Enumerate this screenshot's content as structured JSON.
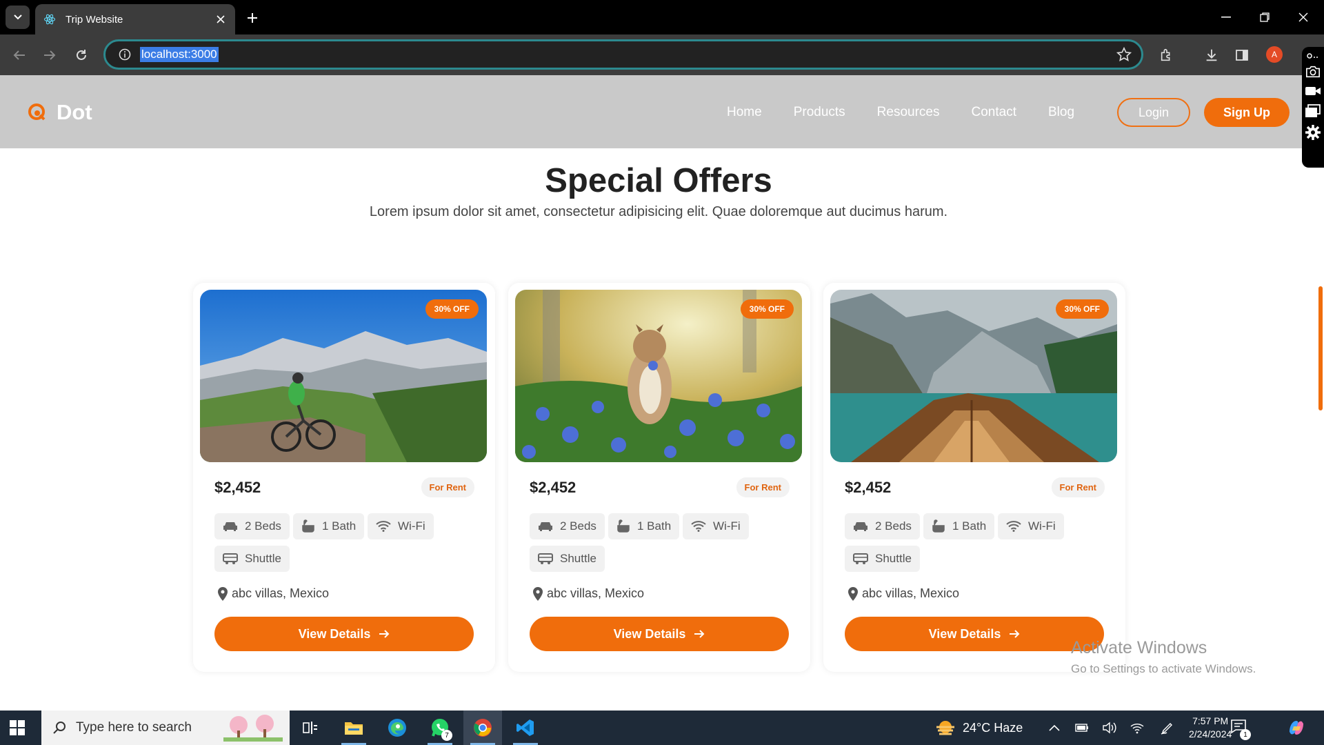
{
  "browser": {
    "tab_title": "Trip Website",
    "url": "localhost:3000",
    "avatar_letter": "A"
  },
  "site": {
    "brand": "Dot",
    "nav": [
      "Home",
      "Products",
      "Resources",
      "Contact",
      "Blog"
    ],
    "login_label": "Login",
    "signup_label": "Sign Up",
    "accent_color": "#f06d0c"
  },
  "section": {
    "title": "Special Offers",
    "subtitle": "Lorem ipsum dolor sit amet, consectetur adipisicing elit. Quae doloremque aut ducimus harum."
  },
  "offers": [
    {
      "badge": "30% OFF",
      "price": "$2,452",
      "tag": "For Rent",
      "beds": "2 Beds",
      "bath": "1 Bath",
      "wifi": "Wi-Fi",
      "shuttle": "Shuttle",
      "location": "abc villas, Mexico",
      "button": "View Details",
      "image": "mountain-biker"
    },
    {
      "badge": "30% OFF",
      "price": "$2,452",
      "tag": "For Rent",
      "beds": "2 Beds",
      "bath": "1 Bath",
      "wifi": "Wi-Fi",
      "shuttle": "Shuttle",
      "location": "abc villas, Mexico",
      "button": "View Details",
      "image": "chipmunk-flowers"
    },
    {
      "badge": "30% OFF",
      "price": "$2,452",
      "tag": "For Rent",
      "beds": "2 Beds",
      "bath": "1 Bath",
      "wifi": "Wi-Fi",
      "shuttle": "Shuttle",
      "location": "abc villas, Mexico",
      "button": "View Details",
      "image": "boat-lake"
    }
  ],
  "watermark": {
    "line1": "Activate Windows",
    "line2": "Go to Settings to activate Windows."
  },
  "taskbar": {
    "search_placeholder": "Type here to search",
    "whatsapp_count": "7",
    "weather": "24°C  Haze",
    "time": "7:57 PM",
    "date": "2/24/2024",
    "notification_count": "1"
  }
}
